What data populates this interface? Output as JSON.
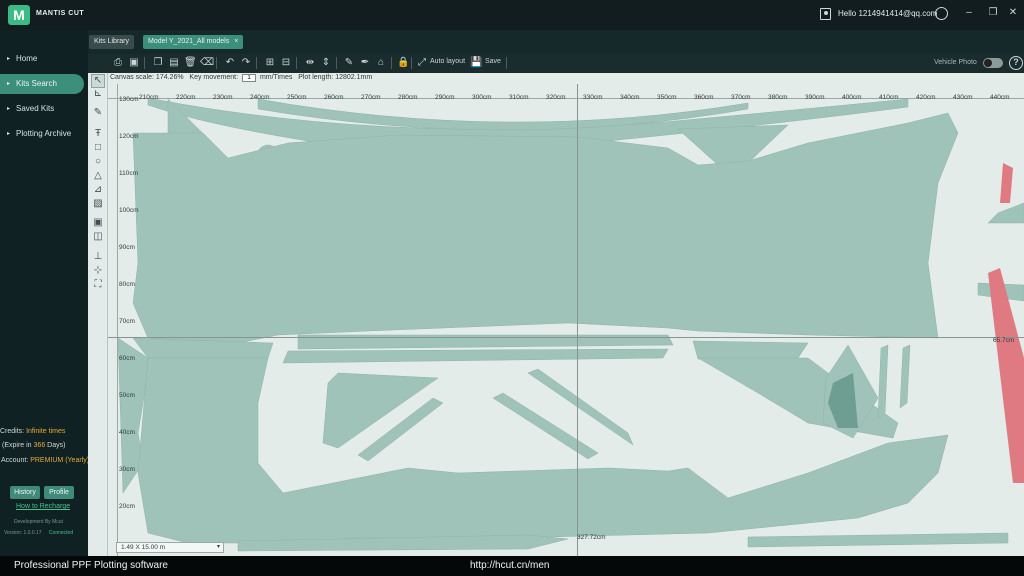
{
  "app": {
    "brand": "MANTIS CUT",
    "greeting": "Hello 1214941414@qq.com"
  },
  "sidebar": {
    "items": [
      {
        "label": "Home"
      },
      {
        "label": "Kits Search"
      },
      {
        "label": "Saved Kits"
      },
      {
        "label": "Plotting Archive"
      }
    ],
    "credits_label": "Credits:",
    "credits_value": "Infinite times",
    "expire_prefix": "(Expire in",
    "expire_days": "366",
    "expire_suffix": "Days)",
    "account_label": "Account:",
    "account_value": "PREMIUM (Yearly)",
    "history_button": "History",
    "profile_button": "Profile",
    "recharge_link": "How to Recharge",
    "developer": "Development By Mcut",
    "version": "Version: 1.0.0.17",
    "status": "Connected"
  },
  "tabs": [
    {
      "label": "Kits Library"
    },
    {
      "label": "Model Y_2021_All models"
    }
  ],
  "toolbar": {
    "auto_layout": "Auto layout",
    "save": "Save",
    "vehicle_photo": "Vehicle Photo"
  },
  "canvas": {
    "scale_label": "Canvas scale:",
    "scale_value": "174.26%",
    "key_movement_label": "Key movement:",
    "key_movement_value": "1",
    "key_movement_unit": "mm/Times",
    "plot_length_label": "Plot length:",
    "plot_length_value": "12802.1mm",
    "ruler_x": [
      "210cm",
      "220cm",
      "230cm",
      "240cm",
      "250cm",
      "260cm",
      "270cm",
      "280cm",
      "290cm",
      "300cm",
      "310cm",
      "320cm",
      "330cm",
      "340cm",
      "350cm",
      "360cm",
      "370cm",
      "380cm",
      "390cm",
      "400cm",
      "410cm",
      "420cm",
      "430cm",
      "440cm"
    ],
    "ruler_y": [
      "130cm",
      "120cm",
      "110cm",
      "100cm",
      "90cm",
      "80cm",
      "70cm",
      "60cm",
      "50cm",
      "40cm",
      "30cm",
      "20cm"
    ],
    "guide_x_label": "327.72cm",
    "guide_y_label": "65.7cm",
    "sheet_size": "1.49 X 15.00 m"
  },
  "colors": {
    "accent": "#3b8f7b",
    "piece_fill": "#9fc2b9",
    "piece_dark": "#6e9e92",
    "highlight_piece": "#e07a82",
    "link": "#49c18f",
    "warning": "#e8a93a"
  },
  "caption": {
    "left": "Professional PPF Plotting software",
    "center": "http://hcut.cn/men"
  }
}
